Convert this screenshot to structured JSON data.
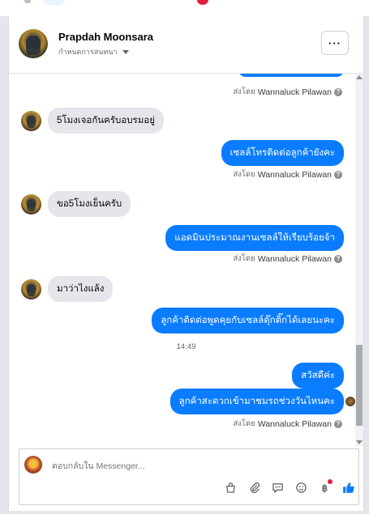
{
  "contact": {
    "name": "Prapdah Moonsara",
    "subtitle": "กำหนดการสนทนา"
  },
  "header": {
    "more_label": "···"
  },
  "sent_by": {
    "prefix": "ส่งโดย",
    "name": "Wannaluck Pilawan"
  },
  "messages": [
    {
      "from": "them",
      "text": "5โมงเจอกันครับอบรมอยู่"
    },
    {
      "from": "me",
      "text": "เซลล์โทรติดต่อลูกค้ายังคะ"
    },
    {
      "from": "them",
      "text": "ขอ5โมงเย็นครับ"
    },
    {
      "from": "me",
      "text": "แอดมินประมาณงานเซลล์ให้เรียบร้อยจ้า"
    },
    {
      "from": "them",
      "text": "มาว่าไงแล้ง"
    },
    {
      "from": "me",
      "text": "ลูกค้าติดต่อพูดคุยกับเซลล์ตุ๊กติ๊กได้เลยนะคะ"
    },
    {
      "from": "me",
      "text": "สวัสดีค่ะ"
    },
    {
      "from": "me",
      "text": "ลูกค้าสะดวกเข้ามาชมรถช่วงวันไหนคะ"
    }
  ],
  "timestamp": "14:49",
  "composer": {
    "placeholder": "ตอบกลับใน Messenger..."
  },
  "colors": {
    "outgoing_bubble": "#0a7cff",
    "incoming_bubble": "#e4e6eb",
    "like_icon": "#0a7cff"
  },
  "icons": [
    "bag-icon",
    "attach-icon",
    "comment-icon",
    "emoji-icon",
    "payment-icon",
    "thumbs-up-icon"
  ]
}
